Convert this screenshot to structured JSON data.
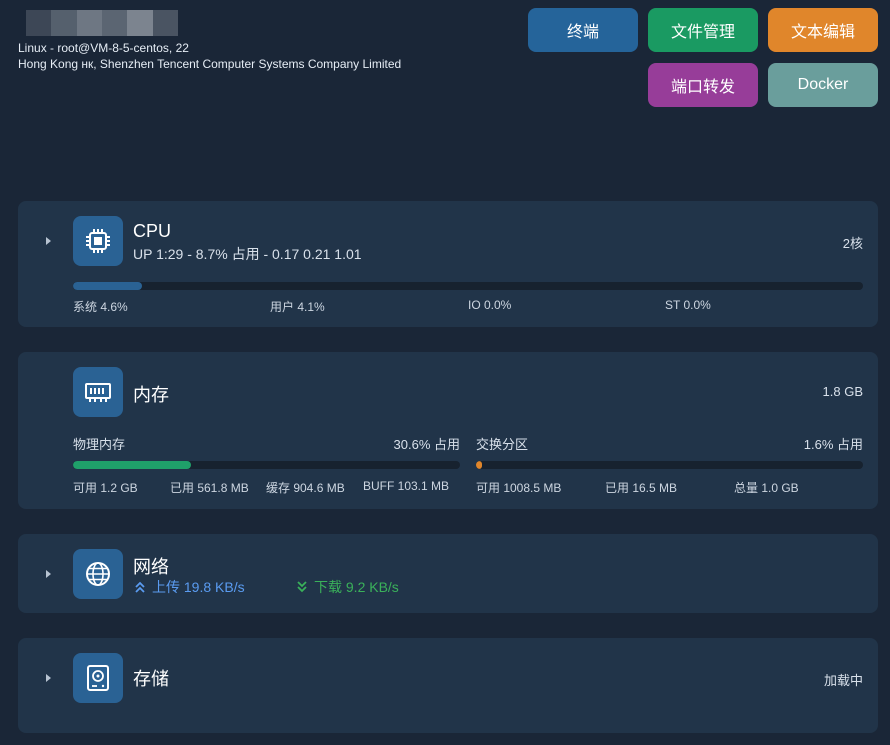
{
  "header": {
    "host_line": "Linux - root@VM-8-5-centos, 22",
    "location_line": "Hong Kong нк, Shenzhen Tencent Computer Systems Company Limited"
  },
  "toolbar": {
    "terminal": "终端",
    "file_manager": "文件管理",
    "text_editor": "文本编辑",
    "port_forward": "端口转发",
    "docker": "Docker"
  },
  "colors": {
    "terminal": "#25649a",
    "file_manager": "#1a9a62",
    "text_editor": "#e0862b",
    "port_forward": "#973d99",
    "docker": "#6a9e9c",
    "cpu_bar": "#2a6294",
    "mem_bar": "#1fa06a",
    "swap_bar": "#e0862b",
    "upload": "#5a9bf0",
    "download": "#3ab15a"
  },
  "cpu": {
    "title": "CPU",
    "subtitle": "UP 1:29 - 8.7% 占用 - 0.17 0.21 1.01",
    "cores": "2核",
    "usage_percent": 8.7,
    "stats": [
      "系统 4.6%",
      "用户 4.1%",
      "IO 0.0%",
      "ST 0.0%"
    ]
  },
  "memory": {
    "title": "内存",
    "total": "1.8 GB",
    "physical_label": "物理内存",
    "physical_usage": "30.6% 占用",
    "physical_percent": 30.6,
    "physical_stats": [
      "可用 1.2 GB",
      "已用 561.8 MB",
      "缓存 904.6 MB",
      "BUFF 103.1 MB"
    ],
    "swap_label": "交换分区",
    "swap_usage": "1.6% 占用",
    "swap_percent": 1.6,
    "swap_stats": [
      "可用 1008.5 MB",
      "已用 16.5 MB",
      "总量 1.0 GB"
    ]
  },
  "network": {
    "title": "网络",
    "upload": "上传 19.8 KB/s",
    "download": "下载 9.2 KB/s"
  },
  "storage": {
    "title": "存储",
    "status": "加载中"
  },
  "icons": {
    "cpu": "chip-icon",
    "memory": "ram-icon",
    "network": "globe-icon",
    "storage": "disk-icon"
  }
}
